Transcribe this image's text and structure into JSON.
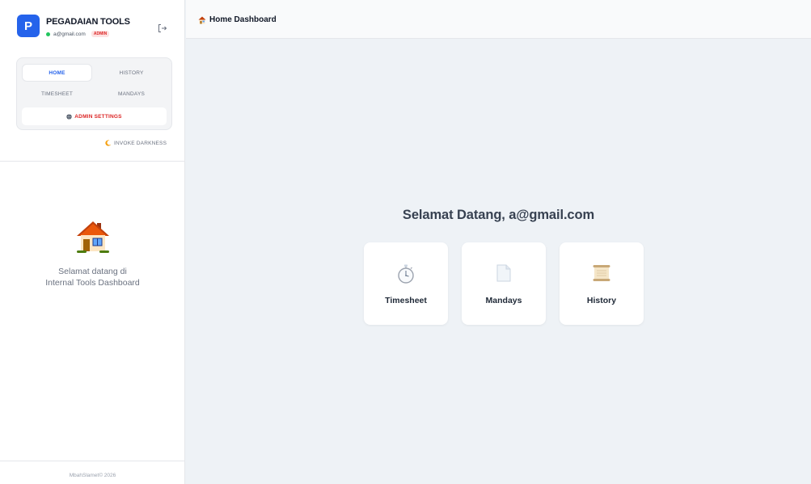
{
  "brand": {
    "avatar_letter": "P",
    "title": "PEGADAIAN TOOLS",
    "email": "a@gmail.com",
    "role_badge": "ADMIN"
  },
  "nav": {
    "home": "HOME",
    "history": "HISTORY",
    "timesheet": "TIMESHEET",
    "mandays": "MANDAYS",
    "admin_settings": "ADMIN SETTINGS",
    "active": "home"
  },
  "theme_toggle": "INVOKE DARKNESS",
  "sidebar_welcome": {
    "line1": "Selamat datang di",
    "line2": "Internal Tools Dashboard"
  },
  "footer": "MbahSlamet© 2026",
  "header": {
    "title": "Home Dashboard"
  },
  "main": {
    "welcome": "Selamat Datang, a@gmail.com",
    "cards": [
      {
        "label": "Timesheet",
        "icon": "stopwatch-icon"
      },
      {
        "label": "Mandays",
        "icon": "document-icon"
      },
      {
        "label": "History",
        "icon": "scroll-icon"
      }
    ]
  },
  "colors": {
    "accent": "#2563eb",
    "danger": "#dc2626",
    "online": "#22c55e",
    "background": "#eef2f6"
  }
}
